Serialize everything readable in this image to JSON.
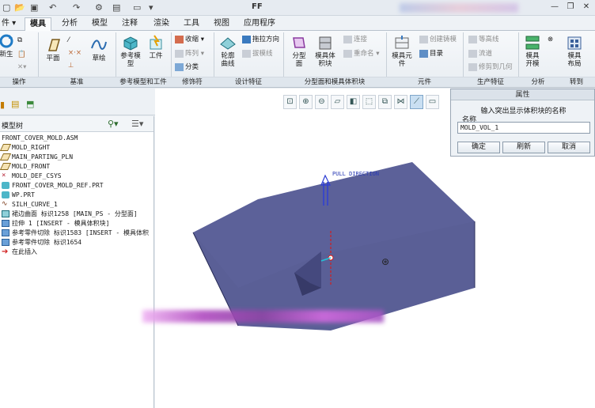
{
  "app": {
    "title": "FF"
  },
  "menu": {
    "tabs": [
      {
        "label": "件 ▾"
      },
      {
        "label": "模具",
        "active": true
      },
      {
        "label": "分析"
      },
      {
        "label": "模型"
      },
      {
        "label": "注释"
      },
      {
        "label": "渲染"
      },
      {
        "label": "工具"
      },
      {
        "label": "视图"
      },
      {
        "label": "应用程序"
      }
    ]
  },
  "ribbon": {
    "groups": [
      {
        "label": "操作"
      },
      {
        "label": "基准"
      },
      {
        "label": "参考模型和工件"
      },
      {
        "label": "修饰符"
      },
      {
        "label": "设计特征"
      },
      {
        "label": "分型面和模具体积块"
      },
      {
        "label": "元件"
      },
      {
        "label": "生产特征"
      },
      {
        "label": "分析"
      },
      {
        "label": "转到"
      }
    ],
    "buttons": {
      "regen": "新生",
      "plane": "平面",
      "sketch": "草绘",
      "ref_model": "参考模\n型",
      "workpiece": "工件",
      "shrink": "收缩",
      "pattern": "阵列",
      "classify": "分类",
      "silhouette": "轮廓\n曲线",
      "drag_dir": "拖拉方向",
      "draft_check": "拔模线",
      "parting_surface": "分型\n面",
      "mold_volume": "模具体\n积块",
      "connect": "连接",
      "rename": "重命名",
      "mold_component": "模具元\n件",
      "create_casting": "创建铸模",
      "catalog": "目录",
      "isoline": "等高线",
      "runner": "流道",
      "mod_geom": "修剪到几何",
      "mold_open": "模具\n开模",
      "mold_layout": "模具\n布局"
    }
  },
  "tree": {
    "title": "模型树",
    "items": [
      {
        "label": "FRONT_COVER_MOLD.ASM",
        "icon": "assembly-icon"
      },
      {
        "label": "MOLD_RIGHT",
        "icon": "datum-plane-icon"
      },
      {
        "label": "MAIN_PARTING_PLN",
        "icon": "datum-plane-icon"
      },
      {
        "label": "MOLD_FRONT",
        "icon": "datum-plane-icon"
      },
      {
        "label": "MOLD_DEF_CSYS",
        "icon": "csys-icon"
      },
      {
        "label": "FRONT_COVER_MOLD_REF.PRT",
        "icon": "part-icon"
      },
      {
        "label": "WP.PRT",
        "icon": "part-icon"
      },
      {
        "label": "SILH_CURVE_1",
        "icon": "curve-icon"
      },
      {
        "label": "裙边曲面 标识1258 [MAIN_PS - 分型面]",
        "icon": "surface-icon"
      },
      {
        "label": "拉伸 1 [INSERT - 模具体积块]",
        "icon": "extrude-icon"
      },
      {
        "label": "参考零件切除 标识1583 [INSERT - 模具体积",
        "icon": "cut-icon"
      },
      {
        "label": "参考零件切除 标识1654",
        "icon": "cut-icon"
      },
      {
        "label": "在此插入",
        "icon": "insert-here-icon"
      }
    ]
  },
  "view": {
    "pull_direction": "PULL DIRECTION",
    "block_color": "#5a5f96"
  },
  "dialog": {
    "title": "属性",
    "message": "输入突出显示体积块的名称",
    "name_label": "名称",
    "name_value": "MOLD_VOL_1",
    "ok": "确定",
    "refresh": "刷新",
    "cancel": "取消"
  }
}
